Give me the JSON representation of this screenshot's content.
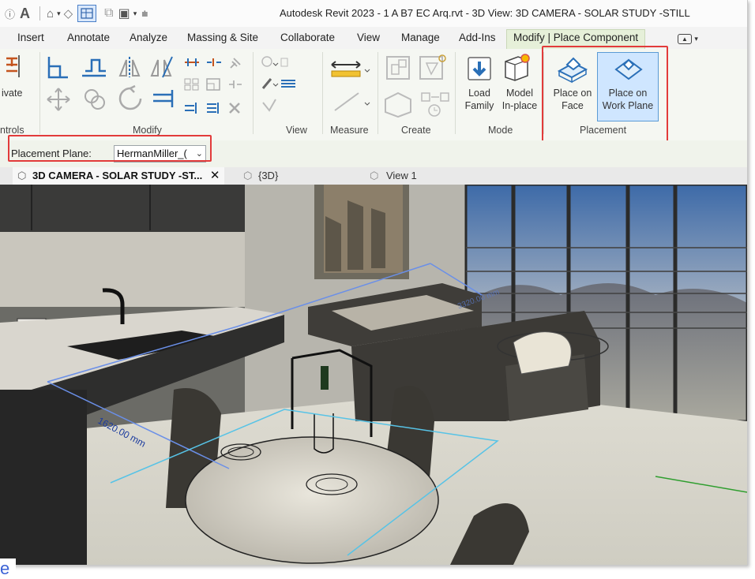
{
  "title_bar": {
    "text": "Autodesk Revit 2023 - 1 A B7 EC Arq.rvt - 3D View: 3D CAMERA - SOLAR STUDY -STILL",
    "quick_access_letter": "A"
  },
  "ribbon_tabs": [
    {
      "label": "Insert"
    },
    {
      "label": "Annotate"
    },
    {
      "label": "Analyze"
    },
    {
      "label": "Massing & Site"
    },
    {
      "label": "Collaborate"
    },
    {
      "label": "View"
    },
    {
      "label": "Manage"
    },
    {
      "label": "Add-Ins"
    },
    {
      "label": "Modify | Place Component",
      "active": true
    }
  ],
  "ribbon": {
    "partial_left_button": "ivate",
    "panels": {
      "controls": "ntrols",
      "modify": "Modify",
      "view": "View",
      "measure": "Measure",
      "create": "Create",
      "mode": "Mode",
      "placement": "Placement"
    },
    "buttons": {
      "load_family": [
        "Load",
        "Family"
      ],
      "model_inplace": [
        "Model",
        "In-place"
      ],
      "place_on_face": [
        "Place on",
        "Face"
      ],
      "place_on_work_plane": [
        "Place on",
        "Work Plane"
      ]
    }
  },
  "options_bar": {
    "label": "Placement Plane:",
    "value": "HermanMiller_("
  },
  "view_tabs": [
    {
      "label": "3D CAMERA - SOLAR STUDY -ST...",
      "active": true,
      "close": "✕"
    },
    {
      "label": "{3D}"
    },
    {
      "label": "View 1"
    }
  ],
  "viewport": {
    "dimension_1": "1620.00 mm",
    "dimension_2": "3320.00 mm"
  },
  "stray_text": "e",
  "colors": {
    "highlight": "#e23b3b",
    "active_tab_bg": "#e6f0d9",
    "selected_button_bg": "#cfe6ff"
  }
}
